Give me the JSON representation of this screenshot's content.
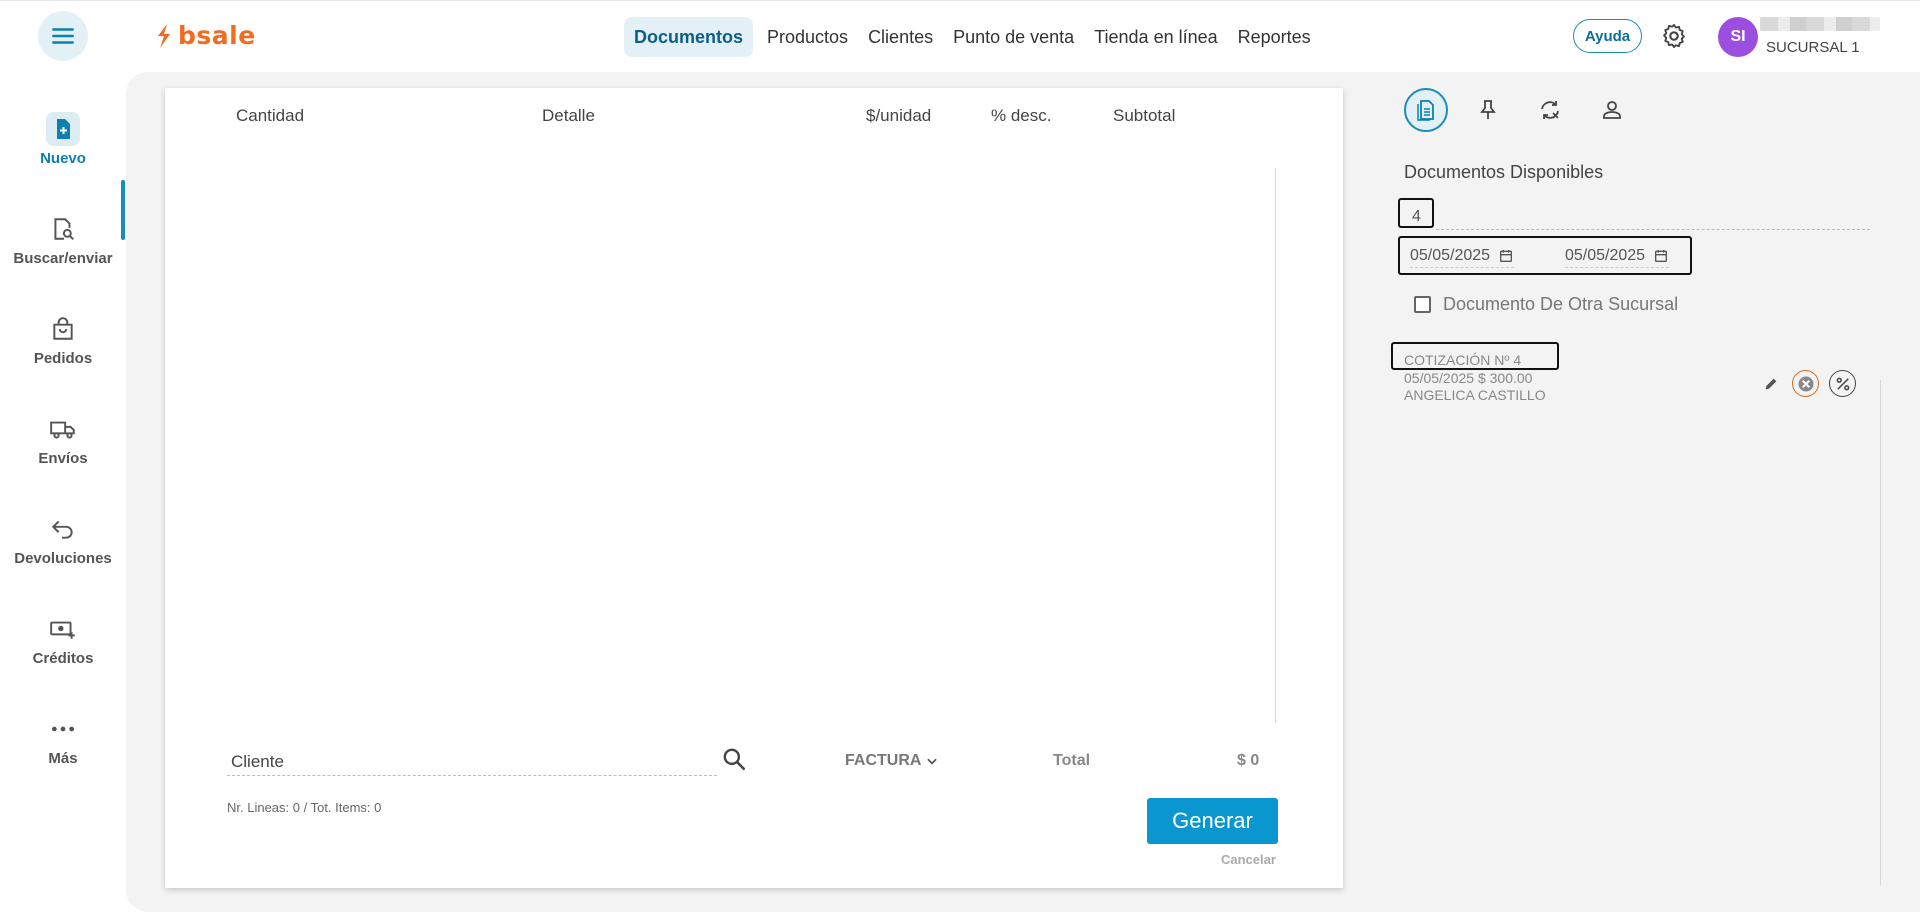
{
  "app": {
    "logo_text": "bsale"
  },
  "nav": {
    "items": [
      "Documentos",
      "Productos",
      "Clientes",
      "Punto de venta",
      "Tienda en línea",
      "Reportes"
    ],
    "active": "Documentos"
  },
  "header": {
    "help_label": "Ayuda",
    "avatar_initials": "SI",
    "branch": "SUCURSAL 1"
  },
  "sidebar": {
    "items": [
      {
        "label": "Nuevo",
        "icon": "new-document-icon"
      },
      {
        "label": "Buscar/enviar",
        "icon": "search-document-icon"
      },
      {
        "label": "Pedidos",
        "icon": "shopping-bag-icon"
      },
      {
        "label": "Envíos",
        "icon": "truck-icon"
      },
      {
        "label": "Devoluciones",
        "icon": "return-arrow-icon"
      },
      {
        "label": "Créditos",
        "icon": "credit-money-icon"
      },
      {
        "label": "Más",
        "icon": "more-dots-icon"
      }
    ]
  },
  "document": {
    "columns": [
      "Cantidad",
      "Detalle",
      "$/unidad",
      "% desc.",
      "Subtotal"
    ],
    "client_placeholder": "Cliente",
    "doc_type": "FACTURA",
    "total_label": "Total",
    "total_value": "$ 0",
    "lines_info": "Nr. Lineas: 0 / Tot. Items: 0",
    "generate_label": "Generar",
    "cancel_label": "Cancelar"
  },
  "right_panel": {
    "title": "Documentos Disponibles",
    "number_filter": "4",
    "date_from": "05/05/2025",
    "date_to": "05/05/2025",
    "other_branch_label": "Documento De Otra Sucursal",
    "quote": {
      "title": "COTIZACIÓN Nº 4",
      "date_amount": "05/05/2025 $ 300.00",
      "client": "ANGELICA CASTILLO"
    }
  },
  "colors": {
    "accent": "#1a8cba",
    "brand": "#f26b21",
    "primary_button": "#0a97cf",
    "avatar": "#9b4ee0"
  }
}
